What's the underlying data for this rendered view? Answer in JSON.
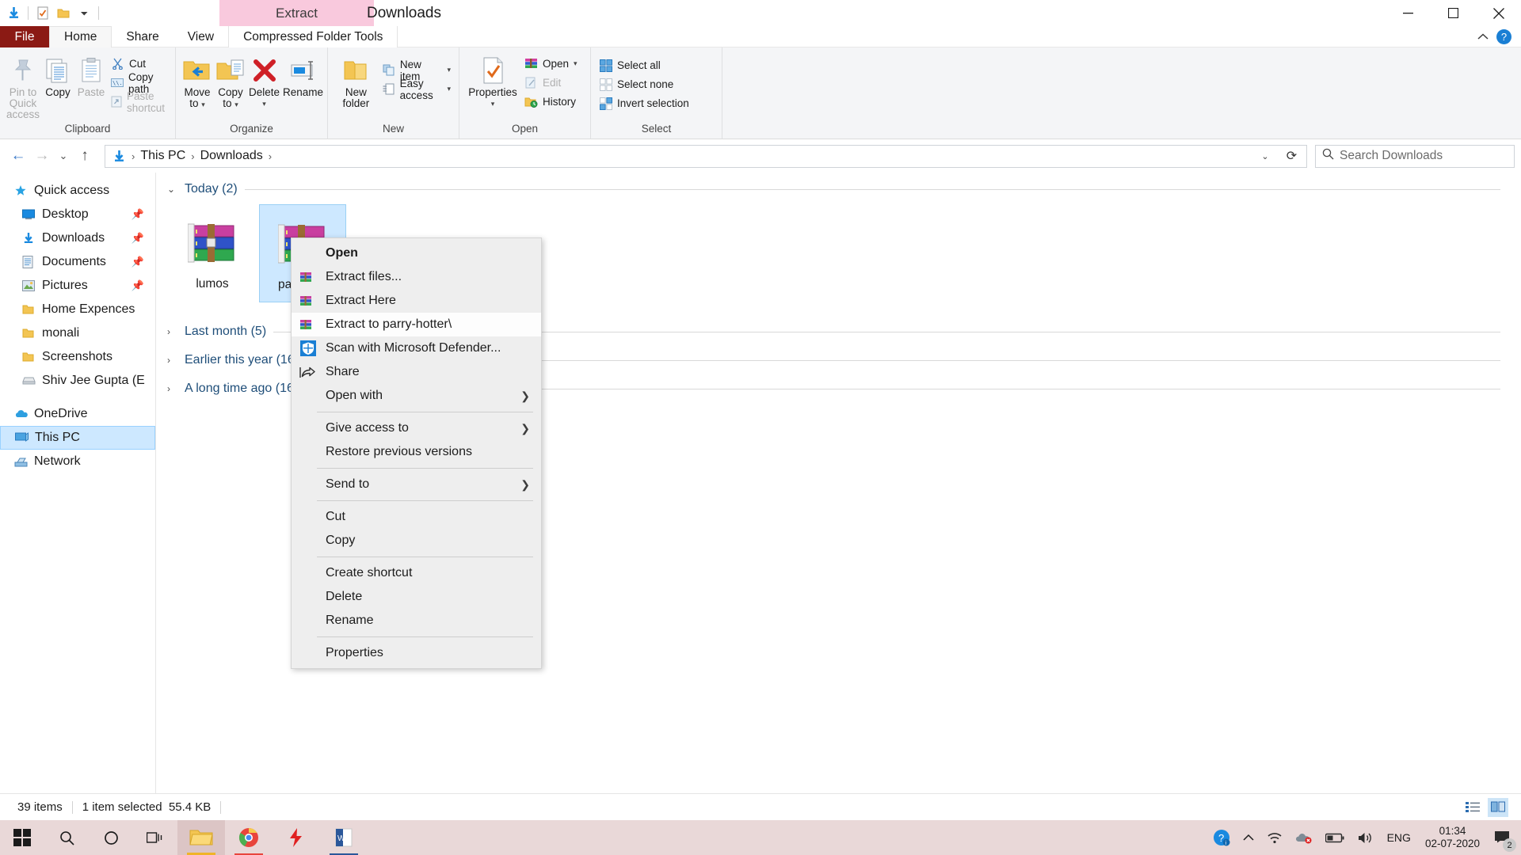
{
  "window": {
    "title": "Downloads",
    "contextual_tab_group": "Extract",
    "minimize_label": "Minimize",
    "maximize_label": "Maximize",
    "close_label": "Close"
  },
  "quick_access_toolbar": {
    "items": [
      {
        "name": "downloads-icon",
        "label": "Downloads"
      },
      {
        "name": "properties-icon",
        "label": "Properties"
      },
      {
        "name": "new-folder-icon",
        "label": "New folder"
      },
      {
        "name": "customize-icon",
        "label": "Customize Quick Access Toolbar"
      }
    ]
  },
  "ribbon": {
    "tabs": [
      {
        "label": "File",
        "id": "file"
      },
      {
        "label": "Home",
        "id": "home"
      },
      {
        "label": "Share",
        "id": "share"
      },
      {
        "label": "View",
        "id": "view"
      },
      {
        "label": "Compressed Folder Tools",
        "id": "compressed-folder-tools"
      }
    ],
    "active_tab": "Home",
    "collapse_label": "Minimize the Ribbon",
    "help_label": "?",
    "groups": [
      {
        "title": "Clipboard",
        "big_buttons": [
          {
            "label": "Pin to Quick\naccess",
            "line1": "Pin to Quick",
            "line2": "access",
            "icon": "pin-icon",
            "dim": true
          },
          {
            "label": "Copy",
            "line1": "Copy",
            "line2": "",
            "icon": "copy-icon",
            "dim": false
          },
          {
            "label": "Paste",
            "line1": "Paste",
            "line2": "",
            "icon": "paste-icon",
            "dim": true
          }
        ],
        "small_buttons": [
          {
            "label": "Cut",
            "icon": "scissors-icon",
            "dim": false
          },
          {
            "label": "Copy path",
            "icon": "copy-path-icon",
            "dim": false
          },
          {
            "label": "Paste shortcut",
            "icon": "paste-shortcut-icon",
            "dim": true
          }
        ]
      },
      {
        "title": "Organize",
        "big_buttons": [
          {
            "line1": "Move",
            "line2": "to",
            "icon": "move-to-icon",
            "caret": true
          },
          {
            "line1": "Copy",
            "line2": "to",
            "icon": "copy-to-icon",
            "caret": true
          },
          {
            "line1": "Delete",
            "line2": "",
            "icon": "delete-icon",
            "caret": true
          },
          {
            "line1": "Rename",
            "line2": "",
            "icon": "rename-icon",
            "caret": false
          }
        ]
      },
      {
        "title": "New",
        "big_buttons": [
          {
            "line1": "New",
            "line2": "folder",
            "icon": "new-folder-icon",
            "caret": false
          }
        ],
        "small_buttons": [
          {
            "label": "New item",
            "icon": "new-item-icon",
            "caret": true
          },
          {
            "label": "Easy access",
            "icon": "easy-access-icon",
            "caret": true
          }
        ]
      },
      {
        "title": "Open",
        "big_buttons": [
          {
            "line1": "Properties",
            "line2": "",
            "icon": "properties-icon",
            "caret": true
          }
        ],
        "small_buttons": [
          {
            "label": "Open",
            "icon": "winrar-icon",
            "caret": true,
            "dim": false
          },
          {
            "label": "Edit",
            "icon": "edit-icon",
            "caret": false,
            "dim": true
          },
          {
            "label": "History",
            "icon": "history-icon",
            "caret": false,
            "dim": false
          }
        ]
      },
      {
        "title": "Select",
        "small_buttons": [
          {
            "label": "Select all",
            "icon": "select-all-icon"
          },
          {
            "label": "Select none",
            "icon": "select-none-icon"
          },
          {
            "label": "Invert selection",
            "icon": "invert-selection-icon"
          }
        ]
      }
    ]
  },
  "addressbar": {
    "back_label": "Back",
    "forward_label": "Forward",
    "recent_label": "Recent locations",
    "up_label": "Up",
    "breadcrumbs": [
      "This PC",
      "Downloads"
    ],
    "dropdown_label": "Previous locations",
    "refresh_label": "Refresh",
    "search_placeholder": "Search Downloads"
  },
  "navpane": {
    "items": [
      {
        "label": "Quick access",
        "icon": "star-pin-icon",
        "root": true,
        "pinned": false,
        "selected": false
      },
      {
        "label": "Desktop",
        "icon": "desktop-icon",
        "root": false,
        "pinned": true,
        "selected": false
      },
      {
        "label": "Downloads",
        "icon": "downloads-icon",
        "root": false,
        "pinned": true,
        "selected": false
      },
      {
        "label": "Documents",
        "icon": "documents-icon",
        "root": false,
        "pinned": true,
        "selected": false
      },
      {
        "label": "Pictures",
        "icon": "pictures-icon",
        "root": false,
        "pinned": true,
        "selected": false
      },
      {
        "label": "Home Expences",
        "icon": "folder-icon",
        "root": false,
        "pinned": false,
        "selected": false
      },
      {
        "label": "monali",
        "icon": "folder-icon",
        "root": false,
        "pinned": false,
        "selected": false
      },
      {
        "label": "Screenshots",
        "icon": "folder-icon",
        "root": false,
        "pinned": false,
        "selected": false
      },
      {
        "label": "Shiv Jee Gupta (E",
        "icon": "drive-icon",
        "root": false,
        "pinned": false,
        "selected": false
      },
      {
        "label": "OneDrive",
        "icon": "onedrive-icon",
        "root": true,
        "pinned": false,
        "selected": false
      },
      {
        "label": "This PC",
        "icon": "thispc-icon",
        "root": true,
        "pinned": false,
        "selected": true
      },
      {
        "label": "Network",
        "icon": "network-icon",
        "root": true,
        "pinned": false,
        "selected": false
      }
    ]
  },
  "content": {
    "groups": [
      {
        "title": "Today (2)",
        "expanded": true,
        "files": [
          {
            "name": "lumos",
            "icon": "winrar-archive-icon",
            "selected": false
          },
          {
            "name": "parry-hot",
            "icon": "winrar-archive-icon",
            "selected": true
          }
        ]
      },
      {
        "title": "Last month (5)",
        "expanded": false,
        "files": []
      },
      {
        "title": "Earlier this year (16)",
        "expanded": false,
        "files": []
      },
      {
        "title": "A long time ago (16)",
        "expanded": false,
        "files": []
      }
    ]
  },
  "context_menu": {
    "items": [
      {
        "label": "Open",
        "type": "item",
        "bold": true,
        "icon": "",
        "arrow": false,
        "highlight": false
      },
      {
        "label": "Extract files...",
        "type": "item",
        "bold": false,
        "icon": "winrar-icon",
        "arrow": false,
        "highlight": false
      },
      {
        "label": "Extract Here",
        "type": "item",
        "bold": false,
        "icon": "winrar-icon",
        "arrow": false,
        "highlight": false
      },
      {
        "label": "Extract to parry-hotter\\",
        "type": "item",
        "bold": false,
        "icon": "winrar-icon",
        "arrow": false,
        "highlight": true
      },
      {
        "label": "Scan with Microsoft Defender...",
        "type": "item",
        "bold": false,
        "icon": "defender-shield-icon",
        "arrow": false,
        "highlight": false
      },
      {
        "label": "Share",
        "type": "item",
        "bold": false,
        "icon": "share-icon",
        "arrow": false,
        "highlight": false
      },
      {
        "label": "Open with",
        "type": "item",
        "bold": false,
        "icon": "",
        "arrow": true,
        "highlight": false
      },
      {
        "type": "separator"
      },
      {
        "label": "Give access to",
        "type": "item",
        "bold": false,
        "icon": "",
        "arrow": true,
        "highlight": false
      },
      {
        "label": "Restore previous versions",
        "type": "item",
        "bold": false,
        "icon": "",
        "arrow": false,
        "highlight": false
      },
      {
        "type": "separator"
      },
      {
        "label": "Send to",
        "type": "item",
        "bold": false,
        "icon": "",
        "arrow": true,
        "highlight": false
      },
      {
        "type": "separator"
      },
      {
        "label": "Cut",
        "type": "item",
        "bold": false,
        "icon": "",
        "arrow": false,
        "highlight": false
      },
      {
        "label": "Copy",
        "type": "item",
        "bold": false,
        "icon": "",
        "arrow": false,
        "highlight": false
      },
      {
        "type": "separator"
      },
      {
        "label": "Create shortcut",
        "type": "item",
        "bold": false,
        "icon": "",
        "arrow": false,
        "highlight": false
      },
      {
        "label": "Delete",
        "type": "item",
        "bold": false,
        "icon": "",
        "arrow": false,
        "highlight": false
      },
      {
        "label": "Rename",
        "type": "item",
        "bold": false,
        "icon": "",
        "arrow": false,
        "highlight": false
      },
      {
        "type": "separator"
      },
      {
        "label": "Properties",
        "type": "item",
        "bold": false,
        "icon": "",
        "arrow": false,
        "highlight": false
      }
    ]
  },
  "statusbar": {
    "item_count": "39 items",
    "selection": "1 item selected",
    "size": "55.4 KB",
    "details_view_label": "Details view",
    "large_icons_view_label": "Large icons view"
  },
  "taskbar": {
    "start_label": "Start",
    "search_label": "Search",
    "cortana_label": "Cortana",
    "taskview_label": "Task View",
    "apps": [
      {
        "name": "file-explorer-taskbar-icon",
        "label": "File Explorer",
        "active": true,
        "accent": "#f0b429"
      },
      {
        "name": "chrome-taskbar-icon",
        "label": "Google Chrome",
        "active": false,
        "accent": "#e8453c"
      },
      {
        "name": "flash-taskbar-icon",
        "label": "Flash",
        "active": false,
        "accent": "#e02020"
      },
      {
        "name": "word-taskbar-icon",
        "label": "Word",
        "active": false,
        "accent": "#2b579a"
      }
    ],
    "tray": [
      {
        "name": "help-tray-icon",
        "label": "Get Help"
      },
      {
        "name": "show-hidden-icons-icon",
        "label": "Show hidden icons"
      },
      {
        "name": "wifi-icon",
        "label": "Network"
      },
      {
        "name": "onedrive-tray-icon",
        "label": "OneDrive"
      },
      {
        "name": "battery-icon",
        "label": "Battery"
      },
      {
        "name": "volume-icon",
        "label": "Volume"
      }
    ],
    "language": "ENG",
    "time": "01:34",
    "date": "02-07-2020",
    "notification_count": "2"
  },
  "colors": {
    "accent_blue": "#0078d7",
    "selection_blue": "#cde8ff",
    "contextual_pink": "#f9c9dd",
    "file_tab_red": "#8b1a14",
    "group_header_blue": "#1f4e79"
  }
}
